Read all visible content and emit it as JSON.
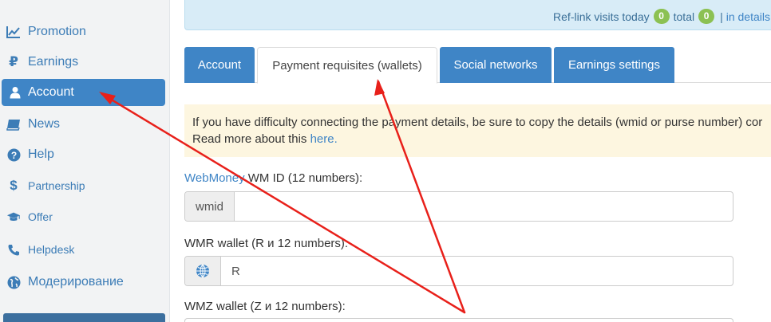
{
  "sidebar": {
    "items": [
      {
        "label": "Promotion",
        "icon": "line-chart-icon"
      },
      {
        "label": "Earnings",
        "icon": "ruble-icon"
      },
      {
        "label": "Account",
        "icon": "user-icon",
        "active": true
      },
      {
        "label": "News",
        "icon": "book-icon"
      },
      {
        "label": "Help",
        "icon": "question-circle-icon"
      },
      {
        "label": "Partnership",
        "icon": "dollar-icon"
      },
      {
        "label": "Offer",
        "icon": "graduation-cap-icon"
      },
      {
        "label": "Helpdesk",
        "icon": "phone-icon"
      },
      {
        "label": "Модерирование",
        "icon": "globe-icon"
      }
    ]
  },
  "banner": {
    "text": "Ref-link visits today",
    "today_count": "0",
    "total_label": "total",
    "total_count": "0",
    "separator": "|",
    "details_link": "in details"
  },
  "tabs": [
    {
      "label": "Account",
      "selected": false
    },
    {
      "label": "Payment requisites (wallets)",
      "selected": true
    },
    {
      "label": "Social networks",
      "selected": false
    },
    {
      "label": "Earnings settings",
      "selected": false
    }
  ],
  "warning": {
    "line1": "If you have difficulty connecting the payment details, be sure to copy the details (wmid or purse number) cor",
    "line2_prefix": "Read more about this ",
    "line2_link": "here."
  },
  "form": {
    "wmid": {
      "label_link": "WebMoney",
      "label_rest": " WM ID (12 numbers):",
      "addon": "wmid",
      "value": ""
    },
    "wmr": {
      "label": "WMR wallet (R и 12 numbers):",
      "addon_icon": "webmoney-globe-icon",
      "placeholder": "R"
    },
    "wmz": {
      "label": "WMZ wallet (Z и 12 numbers):"
    }
  },
  "colors": {
    "accent": "#3f85c6",
    "sidebar_bg": "#f2f3f4",
    "banner_bg": "#d8ecf7",
    "badge": "#8cc152",
    "warning_bg": "#fdf6e0",
    "annotation": "#e8201a"
  }
}
